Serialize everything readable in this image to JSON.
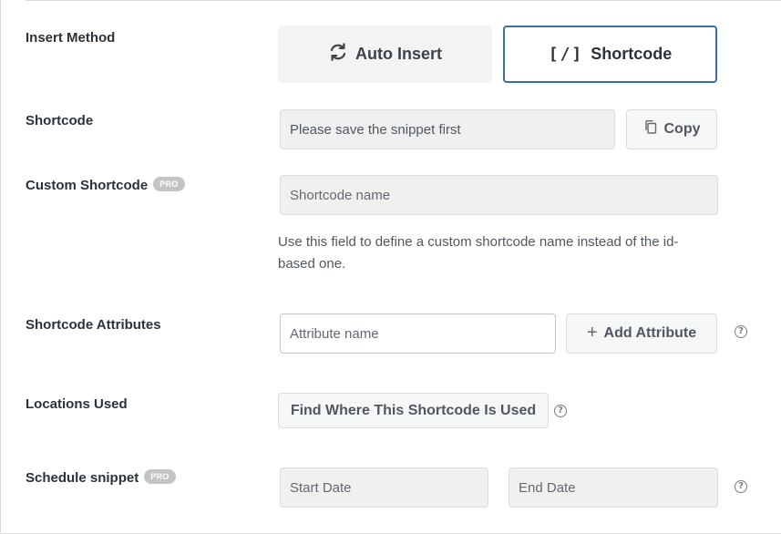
{
  "insert_method": {
    "label": "Insert Method",
    "auto_insert_label": "Auto Insert",
    "shortcode_label": "Shortcode",
    "shortcode_icon_text": "[/]",
    "selected": "Shortcode",
    "selected_border_color": "#3a6ea5"
  },
  "shortcode": {
    "label": "Shortcode",
    "value": "Please save the snippet first",
    "copy_label": "Copy",
    "copy_icon": "copy-icon"
  },
  "custom_shortcode": {
    "label": "Custom Shortcode",
    "badge": "PRO",
    "placeholder": "Shortcode name",
    "description": "Use this field to define a custom shortcode name instead of the id-based one."
  },
  "shortcode_attributes": {
    "label": "Shortcode Attributes",
    "placeholder": "Attribute name",
    "add_label": "Add Attribute",
    "add_icon": "plus-icon",
    "help": "?"
  },
  "locations_used": {
    "label": "Locations Used",
    "button_label": "Find Where This Shortcode Is Used",
    "help": "?"
  },
  "schedule_snippet": {
    "label": "Schedule snippet",
    "badge": "PRO",
    "start_placeholder": "Start Date",
    "end_placeholder": "End Date",
    "help": "?"
  }
}
